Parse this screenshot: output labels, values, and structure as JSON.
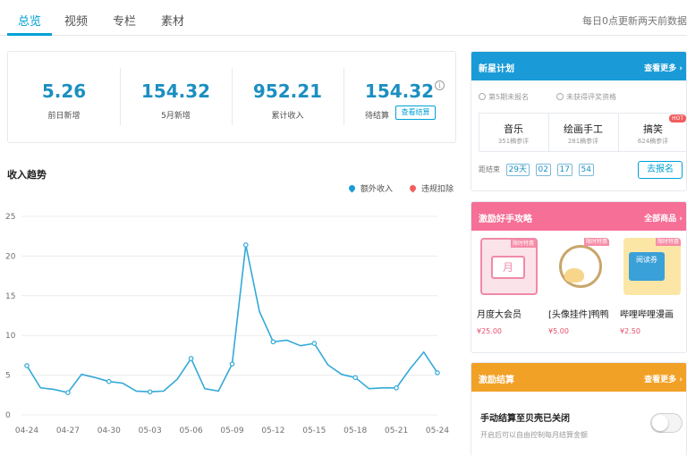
{
  "tabs": [
    {
      "label": "总览",
      "active": true
    },
    {
      "label": "视频",
      "active": false
    },
    {
      "label": "专栏",
      "active": false
    },
    {
      "label": "素材",
      "active": false
    }
  ],
  "notice": "每日0点更新两天前数据",
  "stats": [
    {
      "value": "5.26",
      "label": "前日新增"
    },
    {
      "value": "154.32",
      "label": "5月新增"
    },
    {
      "value": "952.21",
      "label": "累计收入"
    },
    {
      "value": "154.32",
      "label": "待结算"
    }
  ],
  "view_settlement_label": "查看结算",
  "info_icon_glyph": "i",
  "trend": {
    "title": "收入趋势",
    "legend": [
      {
        "label": "额外收入",
        "color": "#1a9bd7"
      },
      {
        "label": "违规扣除",
        "color": "#f25d5d"
      }
    ]
  },
  "chart_data": {
    "type": "line",
    "title": "收入趋势",
    "xlabel": "",
    "ylabel": "",
    "ylim": [
      0,
      25
    ],
    "yticks": [
      0,
      5,
      10,
      15,
      20,
      25
    ],
    "grid": true,
    "legend_position": "top-right",
    "x_labels": [
      "04-24",
      "04-27",
      "04-30",
      "05-03",
      "05-06",
      "05-09",
      "05-12",
      "05-15",
      "05-18",
      "05-21",
      "05-24"
    ],
    "x": [
      "04-24",
      "04-25",
      "04-26",
      "04-27",
      "04-28",
      "04-29",
      "04-30",
      "05-01",
      "05-02",
      "05-03",
      "05-04",
      "05-05",
      "05-06",
      "05-07",
      "05-08",
      "05-09",
      "05-10",
      "05-11",
      "05-12",
      "05-13",
      "05-14",
      "05-15",
      "05-16",
      "05-17",
      "05-18",
      "05-19",
      "05-20",
      "05-21",
      "05-22",
      "05-23",
      "05-24"
    ],
    "series": [
      {
        "name": "额外收入",
        "color": "#1a9bd7",
        "values": [
          6.2,
          3.4,
          3.2,
          2.8,
          5.1,
          4.7,
          4.2,
          4.0,
          3.0,
          2.9,
          3.0,
          4.5,
          7.1,
          3.3,
          3.0,
          6.4,
          21.4,
          13.0,
          9.2,
          9.4,
          8.7,
          9.0,
          6.3,
          5.1,
          4.7,
          3.3,
          3.4,
          3.4,
          5.8,
          7.9,
          5.3
        ],
        "markers": [
          0,
          3,
          6,
          9,
          12,
          15,
          16,
          18,
          21,
          24,
          27,
          30
        ]
      }
    ]
  },
  "star_plan": {
    "title": "新星计划",
    "more": "查看更多",
    "status": [
      "第5期未报名",
      "未获得评奖资格"
    ],
    "categories": [
      {
        "name": "音乐",
        "count": "351稿参评",
        "hot": ""
      },
      {
        "name": "绘画手工",
        "count": "281稿参评",
        "hot": ""
      },
      {
        "name": "搞笑",
        "count": "624稿参评",
        "hot": "HOT"
      }
    ],
    "deadline_label": "距结束",
    "countdown": [
      "29天",
      "02",
      "17",
      "54"
    ],
    "signup": "去报名"
  },
  "shop": {
    "title": "激励好手攻略",
    "more": "全部商品",
    "items": [
      {
        "tag": "限时特惠",
        "name": "月度大会员",
        "price": "¥25.00",
        "thumb_text": "月"
      },
      {
        "tag": "限时特惠",
        "name": "[头像挂件]鸭鸭",
        "price": "¥5.00",
        "thumb_text": ""
      },
      {
        "tag": "限时特惠",
        "name": "哔哩哔哩漫画",
        "price": "¥2.50",
        "thumb_text": "阅读券"
      }
    ]
  },
  "settle": {
    "title": "激励结算",
    "more": "查看更多",
    "toggle_title": "手动结算至贝壳已关闭",
    "toggle_desc": "开启后可以自由控制每月结算金额",
    "toggle_on": false
  },
  "colors": {
    "accent": "#00a1d6",
    "stat_value": "#1c8fc0",
    "star_header": "#1a9bd7",
    "shop_header": "#f56f97",
    "settle_header": "#f2a127",
    "line": "#33a9d8"
  }
}
